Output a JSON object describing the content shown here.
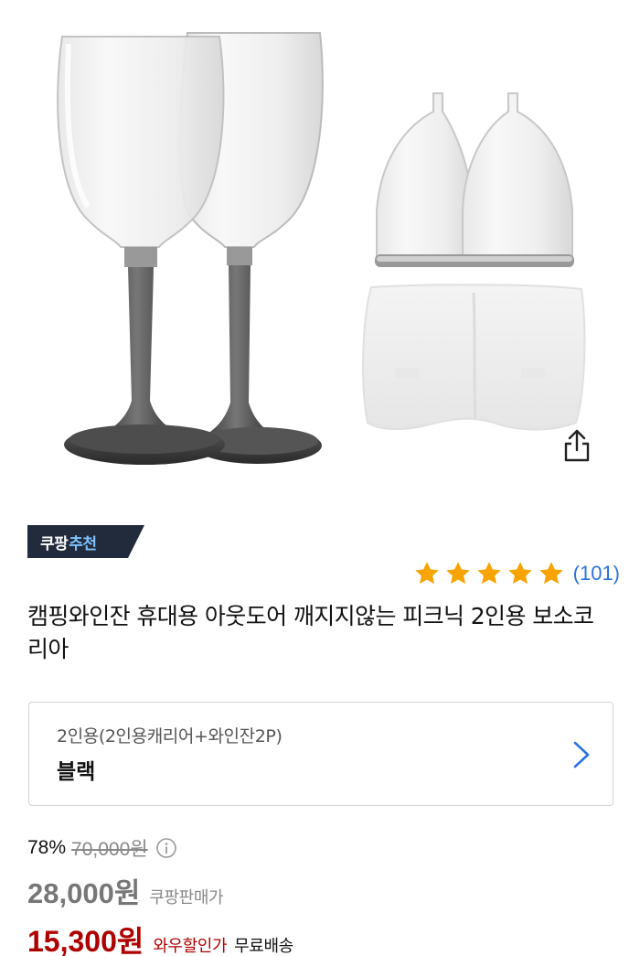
{
  "product": {
    "title": "캠핑와인잔 휴대용 아웃도어 깨지지않는 피크닉 2인용 보소코리아",
    "badge": {
      "prefix": "쿠팡",
      "accent": "추천"
    },
    "rating": {
      "stars": 5,
      "count": "(101)"
    }
  },
  "option": {
    "subtitle": "2인용(2인용캐리어+와인잔2P)",
    "selected": "블랙"
  },
  "price": {
    "discount_percent": "78%",
    "original": "70,000원",
    "sale": "28,000원",
    "sale_label": "쿠팡판매가",
    "wow": "15,300원",
    "wow_label": "와우할인가",
    "shipping": "무료배송"
  },
  "icons": {
    "share": "share-icon",
    "info": "info-icon",
    "chevron": "chevron-right-icon",
    "star": "star-icon"
  },
  "colors": {
    "star": "#f7a400",
    "rating_link": "#2a72e0",
    "wow_price": "#ae0000",
    "badge_bg": "#222b3c",
    "badge_accent": "#7ec3ff"
  }
}
